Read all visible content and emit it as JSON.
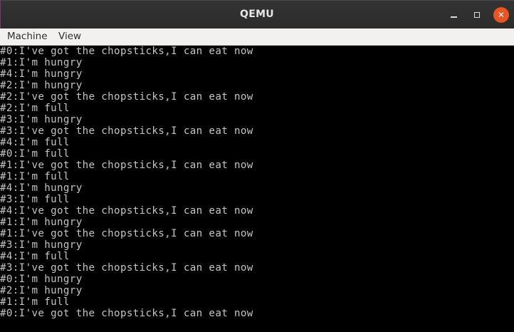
{
  "window": {
    "title": "QEMU",
    "close_glyph": "✕"
  },
  "menubar": {
    "items": [
      "Machine",
      "View"
    ]
  },
  "console": {
    "lines": [
      "#0:I've got the chopsticks,I can eat now",
      "#1:I'm hungry",
      "#4:I'm hungry",
      "#2:I'm hungry",
      "#2:I've got the chopsticks,I can eat now",
      "#2:I'm full",
      "#3:I'm hungry",
      "#3:I've got the chopsticks,I can eat now",
      "#4:I'm full",
      "#0:I'm full",
      "#1:I've got the chopsticks,I can eat now",
      "#1:I'm full",
      "#4:I'm hungry",
      "#3:I'm full",
      "#4:I've got the chopsticks,I can eat now",
      "#1:I'm hungry",
      "#1:I've got the chopsticks,I can eat now",
      "#3:I'm hungry",
      "#4:I'm full",
      "#3:I've got the chopsticks,I can eat now",
      "#0:I'm hungry",
      "#2:I'm hungry",
      "#1:I'm full",
      "#0:I've got the chopsticks,I can eat now"
    ]
  },
  "colors": {
    "console_text": "#c4c4c4",
    "console_bg": "#000000",
    "close_button": "#e95420"
  }
}
